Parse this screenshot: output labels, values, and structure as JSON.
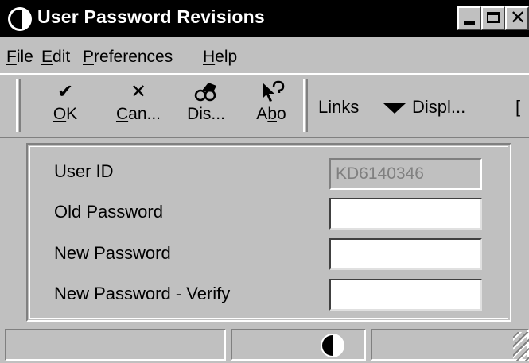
{
  "window": {
    "title": "User Password Revisions"
  },
  "menu": [
    {
      "label": "File",
      "mnemonic": "F",
      "rest": "ile"
    },
    {
      "label": "Edit",
      "mnemonic": "E",
      "rest": "dit"
    },
    {
      "label": "Preferences",
      "mnemonic": "P",
      "rest": "references"
    },
    {
      "label": "Help",
      "mnemonic": "H",
      "rest": "elp"
    }
  ],
  "toolbar": {
    "ok": {
      "icon": "check-icon",
      "pre": "",
      "mn": "O",
      "post": "K"
    },
    "cancel": {
      "icon": "x-icon",
      "pre": "",
      "mn": "C",
      "post": "an..."
    },
    "display": {
      "icon": "binoculars-icon",
      "text": "Dis..."
    },
    "about": {
      "icon": "pointer-question-icon",
      "pre": "A",
      "mn": "b",
      "post": "o"
    },
    "links": "Links",
    "display_menu": "Displ...",
    "trailing": "["
  },
  "form": {
    "user_id": {
      "label": "User ID",
      "value": "KD6140346"
    },
    "old_password": {
      "label": "Old Password",
      "value": ""
    },
    "new_password": {
      "label": "New Password",
      "value": ""
    },
    "new_password_verify": {
      "label": "New Password - Verify",
      "value": ""
    }
  }
}
